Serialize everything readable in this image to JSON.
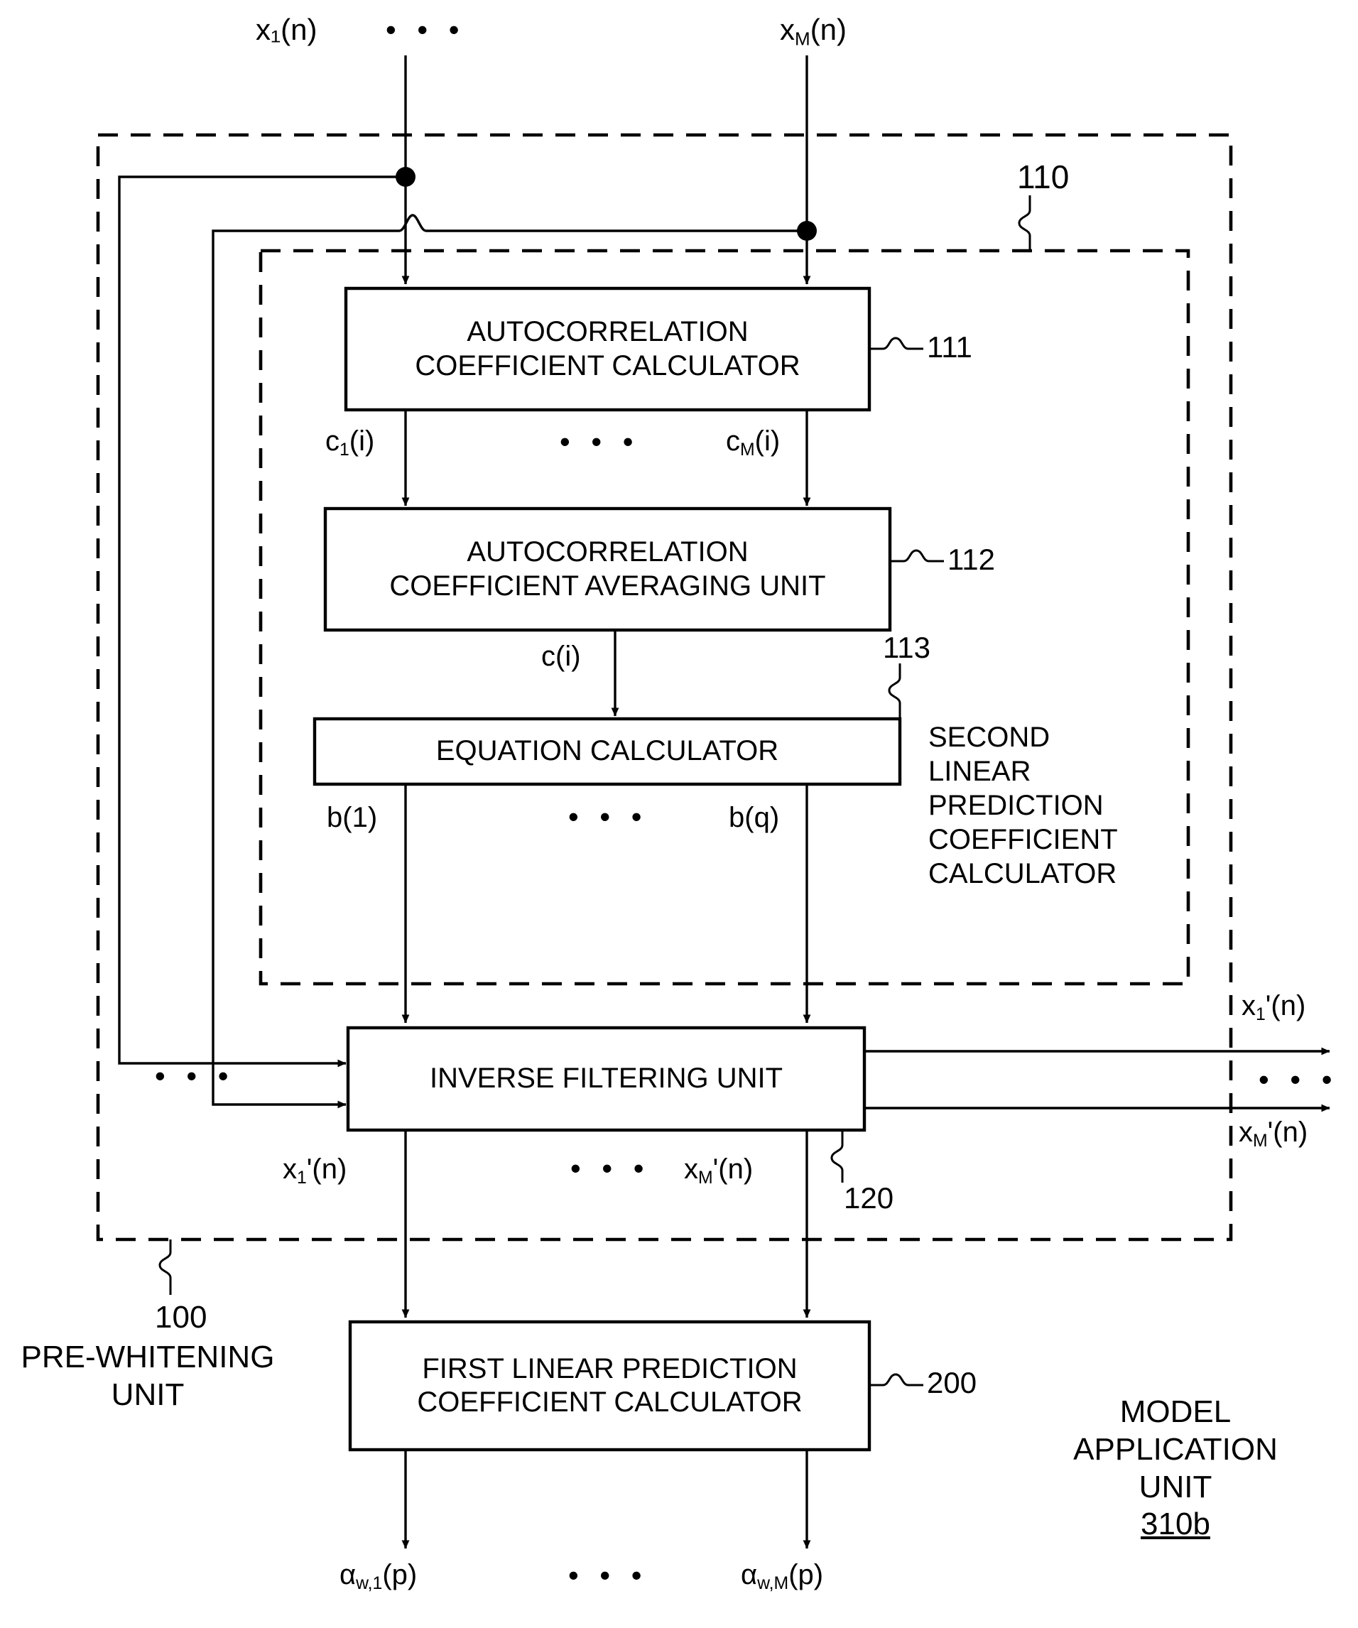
{
  "figure": {
    "type": "patent-block-diagram",
    "title": "",
    "reference_numerals": {
      "pre_whitening_unit": "100",
      "second_lpc_calculator": "110",
      "autocorrelation_coefficient_calculator": "111",
      "autocorrelation_coefficient_averaging_unit": "112",
      "equation_calculator": "113",
      "inverse_filtering_unit": "120",
      "first_lpc_calculator": "200",
      "model_application_unit": "310b"
    }
  },
  "inputs": {
    "x1": "x₁(n)",
    "ellipsis": "• • •",
    "xM": "x",
    "xM_sub": "M",
    "xM_tail": "(n)"
  },
  "signals": {
    "c1": "c",
    "c1_sub": "1",
    "c1_tail": "(i)",
    "cM": "c",
    "cM_sub": "M",
    "cM_tail": "(i)",
    "c": "c(i)",
    "b1": "b(1)",
    "bq": "b(q)",
    "ellipsis": "• • •",
    "x1_prime": "x",
    "x1_prime_sub": "1",
    "x1_prime_tail": "'(n)",
    "xM_prime": "x",
    "xM_prime_sub": "M",
    "xM_prime_tail": "'(n)",
    "alpha1": "α",
    "alpha1_sub": "w,1",
    "alpha1_tail": "(p)",
    "alphaM": "α",
    "alphaM_sub": "w,M",
    "alphaM_tail": "(p)"
  },
  "blocks": {
    "autocorrelation_calculator": {
      "line1": "AUTOCORRELATION",
      "line2": "COEFFICIENT CALCULATOR",
      "ref": "111"
    },
    "averaging_unit": {
      "line1": "AUTOCORRELATION",
      "line2": "COEFFICIENT AVERAGING UNIT",
      "ref": "112"
    },
    "equation_calculator": {
      "line1": "EQUATION CALCULATOR",
      "ref": "113"
    },
    "inverse_filtering_unit": {
      "line1": "INVERSE FILTERING UNIT",
      "ref": "120"
    },
    "first_lpc_calculator": {
      "line1": "FIRST LINEAR PREDICTION",
      "line2": "COEFFICIENT CALCULATOR",
      "ref": "200"
    }
  },
  "annotations": {
    "second_lpc": [
      "SECOND",
      "LINEAR",
      "PREDICTION",
      "COEFFICIENT",
      "CALCULATOR"
    ],
    "second_lpc_ref": "110",
    "pre_whitening": [
      "PRE-WHITENING",
      "UNIT"
    ],
    "pre_whitening_ref": "100",
    "model_application": [
      "MODEL",
      "APPLICATION",
      "UNIT"
    ],
    "model_application_ref": "310b"
  },
  "colors": {
    "stroke": "#000000",
    "background": "#ffffff"
  }
}
